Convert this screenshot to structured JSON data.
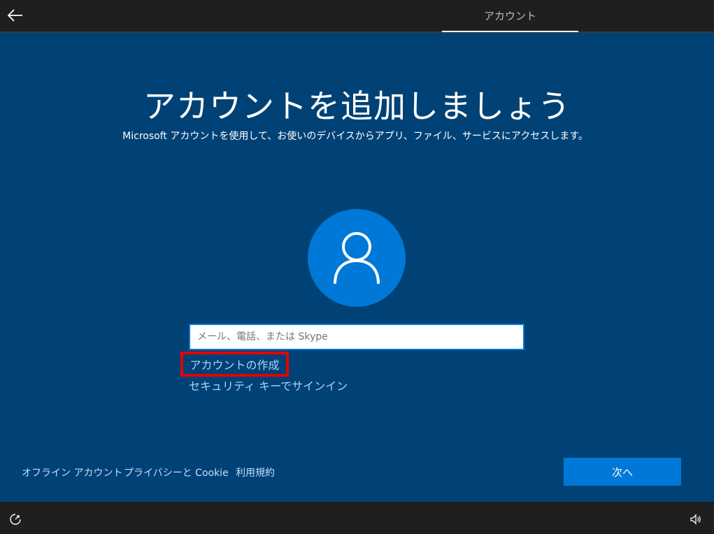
{
  "header": {
    "back_icon": "arrow-left-icon",
    "tab_label": "アカウント"
  },
  "main": {
    "title": "アカウントを追加しましょう",
    "subtitle": "Microsoft アカウントを使用して、お使いのデバイスからアプリ、ファイル、サービスにアクセスします。",
    "avatar_icon": "user-icon",
    "email_placeholder": "メール、電話、または Skype",
    "email_value": "",
    "create_account_label": "アカウントの作成",
    "security_key_label": "セキュリティ キーでサインイン"
  },
  "footer": {
    "offline_account": "オフライン アカウント",
    "privacy_cookie": "プライバシーと Cookie",
    "terms": "利用規約",
    "next_label": "次へ"
  },
  "bottombar": {
    "ease_of_access_icon": "ease-of-access-icon",
    "volume_icon": "volume-icon"
  },
  "colors": {
    "background": "#004275",
    "accent": "#0078d7",
    "highlight": "#e60000",
    "link": "#a8d4ff",
    "bar": "#1f1f1f"
  }
}
